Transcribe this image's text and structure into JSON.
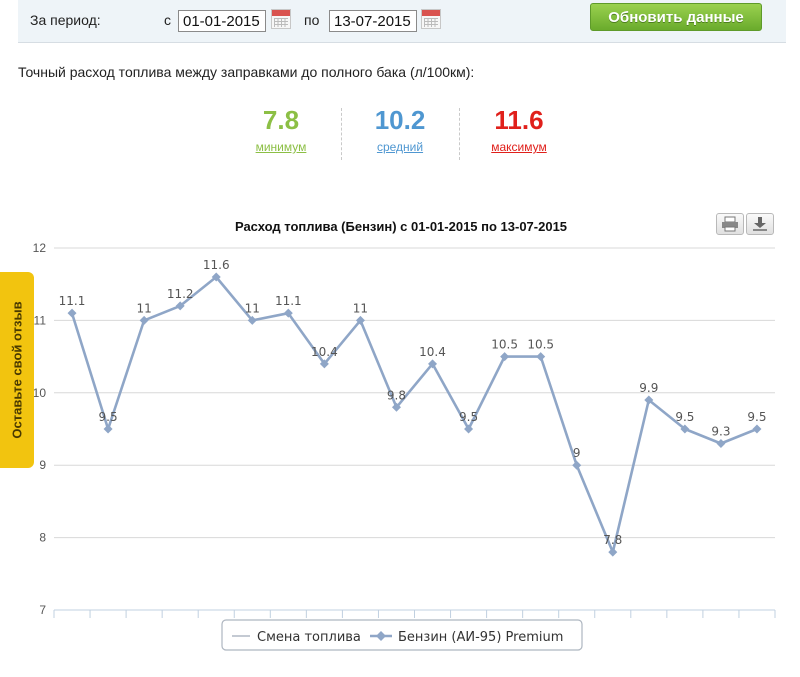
{
  "filter": {
    "period_label": "За период:",
    "from_label": "с",
    "from_value": "01-01-2015",
    "to_label": "по",
    "to_value": "13-07-2015",
    "refresh_label": "Обновить данные"
  },
  "description": "Точный расход топлива между заправками до полного бака (л/100км):",
  "stats": {
    "min": {
      "value": "7.8",
      "label": "минимум",
      "color": "#8cbf45"
    },
    "avg": {
      "value": "10.2",
      "label": "средний",
      "color": "#4f97d1"
    },
    "max": {
      "value": "11.6",
      "label": "максимум",
      "color": "#e0201b"
    }
  },
  "feedback_tab": "Оставьте свой отзыв",
  "chart_data": {
    "type": "line",
    "title": "Расход топлива (Бензин) с 01-01-2015 по 13-07-2015",
    "ylim": [
      7,
      12
    ],
    "yticks": [
      7,
      8,
      9,
      10,
      11,
      12
    ],
    "grid": true,
    "legend_position": "bottom-center",
    "series": [
      {
        "name": "Смена топлива",
        "color": "#c4cad3",
        "values": []
      },
      {
        "name": "Бензин (АИ-95) Premium",
        "color": "#8fa6c7",
        "values": [
          11.1,
          9.5,
          11,
          11.2,
          11.6,
          11,
          11.1,
          10.4,
          11,
          9.8,
          10.4,
          9.5,
          10.5,
          10.5,
          9,
          7.8,
          9.9,
          9.5,
          9.3,
          9.5
        ]
      }
    ]
  }
}
